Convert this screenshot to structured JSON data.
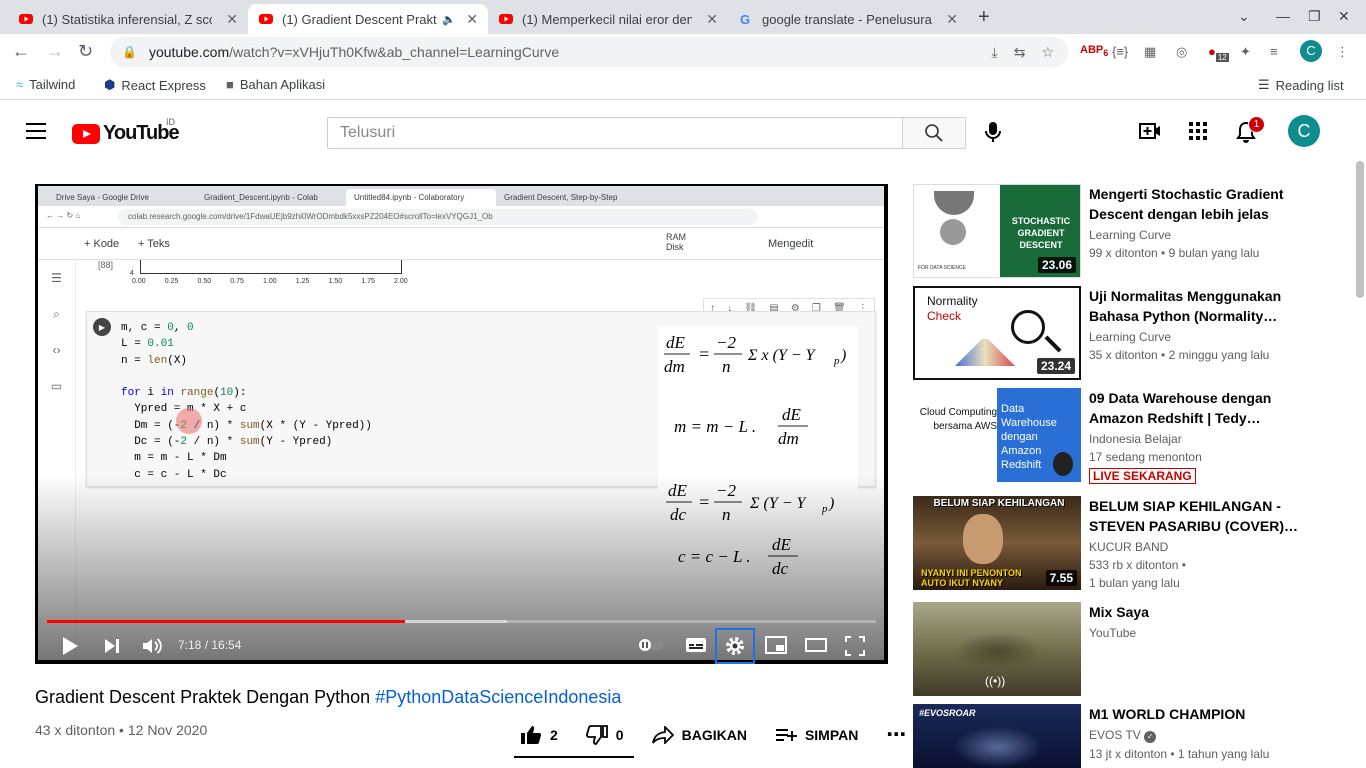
{
  "browser": {
    "tabs": [
      {
        "title": "(1) Statistika inferensial, Z sco"
      },
      {
        "title": "(1) Gradient Descent Prakt"
      },
      {
        "title": "(1) Memperkecil nilai eror den"
      },
      {
        "title": "google translate - Penelusura"
      }
    ],
    "url": {
      "host": "youtube.com",
      "path": "/watch?v=xVHjuTh0Kfw&ab_channel=LearningCurve"
    },
    "ext_badges": {
      "abp": "6",
      "red": "12"
    },
    "bookmarks": [
      "Tailwind",
      "React Express",
      "Bahan Aplikasi"
    ],
    "reading_list": "Reading list"
  },
  "header": {
    "logo_text": "YouTube",
    "country": "ID",
    "search_placeholder": "Telusuri",
    "notif_count": "1",
    "avatar_letter": "C"
  },
  "video_frame": {
    "colab_tabs": [
      "Drive Saya - Google Drive",
      "Gradient_Descent.ipynb - Colab",
      "Untitled84.ipynb - Colaboratory",
      "Gradient Descent, Step-by-Step"
    ],
    "colab_url": "colab.research.google.com/drive/1FdwaUEjb9zhi0WrODmbdk5xxsPZ204EO#scrollTo=lexVYQGJ1_Ob",
    "menu": {
      "add_code": "+ Kode",
      "add_text": "+ Teks",
      "ram": "RAM",
      "disk": "Disk",
      "edit": "Mengedit"
    },
    "chart_fragment": {
      "cell_label": "[88]",
      "ytick": "4",
      "xticks": [
        "0.00",
        "0.25",
        "0.50",
        "0.75",
        "1.00",
        "1.25",
        "1.50",
        "1.75",
        "2.00"
      ]
    },
    "code_lines": [
      "m, c = 0, 0",
      "L = 0.01",
      "n = len(X)",
      "",
      "for i in range(10):",
      "  Ypred = m * X + c",
      "  Dm = (-2 / n) * sum(X * (Y - Ypred))",
      "  Dc = (-2 / n) * sum(Y - Ypred)",
      "  m = m - L * Dm",
      "  c = c - L * Dc"
    ]
  },
  "player": {
    "time": "7:18 / 16:54",
    "progress": 0.432
  },
  "video": {
    "title": "Gradient Descent Praktek Dengan Python ",
    "hashtag": "#PythonDataScienceIndonesia",
    "meta": "43 x ditonton • 12 Nov 2020",
    "likes": "2",
    "dislikes": "0",
    "share": "BAGIKAN",
    "save": "SIMPAN"
  },
  "recommendations": [
    {
      "title": "Mengerti Stochastic Gradient Descent dengan lebih jelas",
      "channel": "Learning Curve",
      "meta": "99 x ditonton • 9 bulan yang lalu",
      "duration": "23.06",
      "thumb_text": "STOCHASTIC GRADIENT DESCENT",
      "thumb_sub": "FOR DATA SCIENCE"
    },
    {
      "title": "Uji Normalitas Menggunakan Bahasa Python (Normality…",
      "channel": "Learning Curve",
      "meta": "35 x ditonton • 2 minggu yang lalu",
      "duration": "23.24",
      "thumb_text": "Normality",
      "thumb_sub": "Check"
    },
    {
      "title": "09 Data Warehouse dengan Amazon Redshift | Tedy…",
      "channel": "Indonesia Belajar",
      "meta": "17 sedang menonton",
      "live": "LIVE SEKARANG",
      "thumb_text": "Data Warehouse dengan Amazon Redshift",
      "thumb_sub": "Cloud Computing bersama AWS"
    },
    {
      "title": "BELUM SIAP KEHILANGAN - STEVEN PASARIBU (COVER)…",
      "channel": "KUCUR BAND",
      "meta": "533 rb x ditonton •",
      "meta2": "1 bulan yang lalu",
      "duration": "7.55",
      "thumb_text": "BELUM SIAP KEHILANGAN",
      "thumb_sub": "NYANYI INI PENONTON AUTO IKUT NYANY"
    },
    {
      "title": "Mix Saya",
      "channel": "YouTube",
      "meta": ""
    },
    {
      "title": "M1 WORLD CHAMPION",
      "channel": "EVOS TV",
      "meta": "13 jt x ditonton • 1 tahun yang lalu",
      "thumb_text": "#EVOSROAR"
    }
  ],
  "colors": {
    "yt_red": "#ff0000",
    "link_blue": "#065fd4",
    "avatar": "#0f8d8d"
  }
}
